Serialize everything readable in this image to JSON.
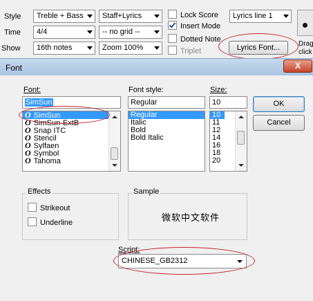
{
  "toolbar": {
    "rows": [
      {
        "label": "Style"
      },
      {
        "label": "Time"
      },
      {
        "label": "Show"
      }
    ],
    "style_value": "Treble + Bass",
    "time_value": "4/4",
    "show_value": "16th notes",
    "staff_value": "Staff+Lyrics",
    "grid_value": "-- no grid --",
    "zoom_value": "Zoom 100%",
    "lock_score": "Lock Score",
    "insert_mode": "Insert Mode",
    "dotted_note": "Dotted Note",
    "triplet": "Triplet",
    "lyrics_line_value": "Lyrics line 1",
    "lyrics_font_button": "Lyrics Font...",
    "cut_text_1": "Drag",
    "cut_text_2": "click"
  },
  "dialog": {
    "title": "Font",
    "close_label": "X",
    "font_label": "Font:",
    "font_value": "SimSun",
    "font_list": [
      "SimSun",
      "SimSun-ExtB",
      "Snap ITC",
      "Stencil",
      "Sylfaen",
      "Symbol",
      "Tahoma"
    ],
    "font_glyph": "O",
    "style_label": "Font style:",
    "style_value": "Regular",
    "style_list": [
      "Regular",
      "Italic",
      "Bold",
      "Bold Italic"
    ],
    "size_label": "Size:",
    "size_value": "10",
    "size_list": [
      "10",
      "11",
      "12",
      "14",
      "16",
      "18",
      "20"
    ],
    "ok_label": "OK",
    "cancel_label": "Cancel",
    "effects_label": "Effects",
    "strikeout_label": "Strikeout",
    "underline_label": "Underline",
    "sample_label": "Sample",
    "sample_text": "微软中文软件",
    "script_label": "Script:",
    "script_value": "CHINESE_GB2312"
  },
  "colors": {
    "selection": "#3399ff",
    "annotation_ellipse": "#c8242c"
  }
}
